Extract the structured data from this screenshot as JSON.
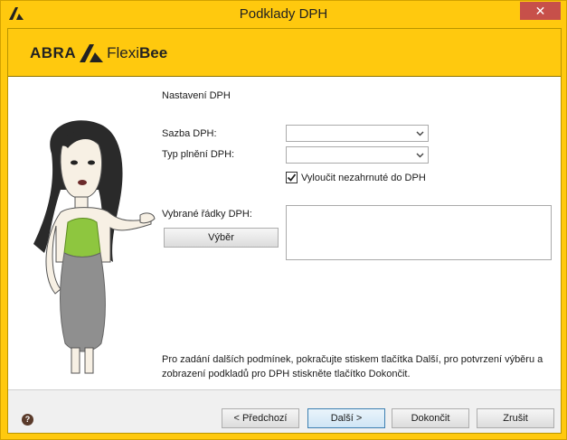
{
  "window": {
    "title": "Podklady DPH",
    "close_symbol": "✕"
  },
  "brand": {
    "abra": "ABRA",
    "flexi": "Flexi",
    "bee": "Bee"
  },
  "form": {
    "section_title": "Nastavení DPH",
    "vat_rate_label": "Sazba DPH:",
    "vat_rate_value": "",
    "supply_type_label": "Typ plnění DPH:",
    "supply_type_value": "",
    "exclude_label": "Vyloučit nezahrnuté do DPH",
    "exclude_checked": true,
    "selected_rows_label": "Vybrané řádky DPH:",
    "select_button": "Výběr",
    "hint": "Pro zadání dalších podmínek, pokračujte stiskem tlačítka Další, pro potvrzení výběru a zobrazení podkladů pro DPH stiskněte tlačítko Dokončit."
  },
  "footer": {
    "help_symbol": "?",
    "prev_button": "< Předchozí",
    "next_button": "Další >",
    "finish_button": "Dokončit",
    "cancel_button": "Zrušit"
  },
  "colors": {
    "accent": "#ffc90e",
    "close": "#c7504a",
    "shirt": "#8ec63f"
  }
}
